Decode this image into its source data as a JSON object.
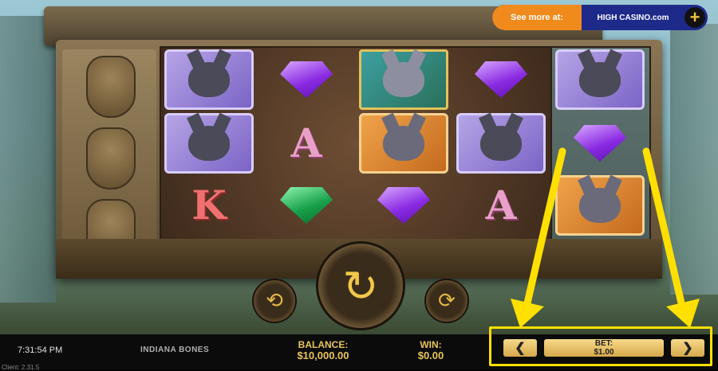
{
  "promo": {
    "label": "See more at:",
    "brand": "HIGH CASINO.com",
    "plus": "+"
  },
  "reels": {
    "r1": [
      "wolf",
      "wolf",
      "K"
    ],
    "r2": [
      "purple-gem",
      "A",
      "green-gem"
    ],
    "r3": [
      "wild",
      "dog",
      "purple-gem"
    ],
    "r4": [
      "purple-gem",
      "wolf",
      "A"
    ],
    "r5": [
      "wolf",
      "purple-gem",
      "dog"
    ]
  },
  "symbols": {
    "letter_a": "A",
    "letter_k": "K"
  },
  "controls": {
    "spin_icon": "↻",
    "autoplay_icon": "⟲",
    "quick_icon": "⟳"
  },
  "status": {
    "time": "7:31:54 PM",
    "client": "Client: 2.31.5",
    "game_name": "INDIANA BONES",
    "balance_label": "BALANCE:",
    "balance_value": "$10,000.00",
    "win_label": "WIN:",
    "win_value": "$0.00",
    "bet_label": "BET:",
    "bet_value": "$1.00",
    "bet_decrease": "❮",
    "bet_increase": "❯"
  },
  "colors": {
    "highlight": "#ffe000",
    "gold": "#e8c45a",
    "promo_orange": "#f08a1c",
    "promo_blue": "#1e2a8a"
  }
}
